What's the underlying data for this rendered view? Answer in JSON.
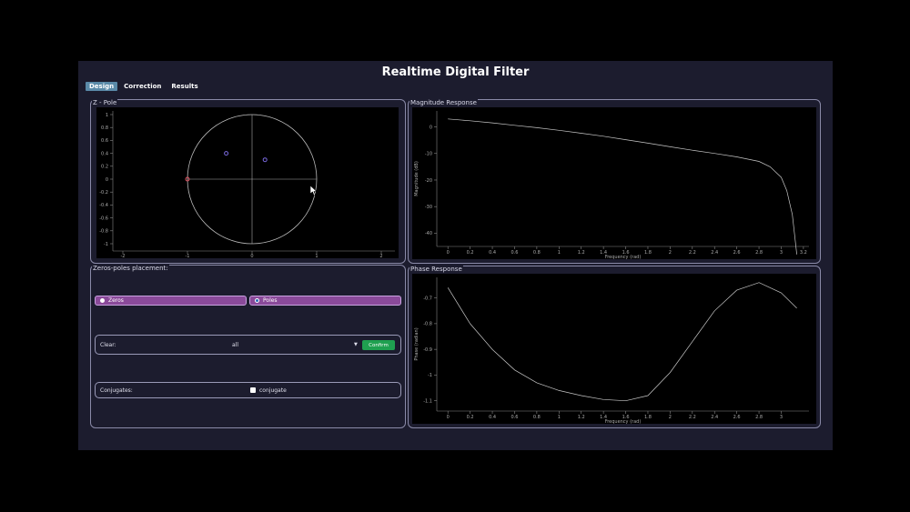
{
  "app": {
    "title": "Realtime Digital Filter"
  },
  "tabs": [
    {
      "label": "Design",
      "active": true
    },
    {
      "label": "Correction",
      "active": false
    },
    {
      "label": "Results",
      "active": false
    }
  ],
  "zpole": {
    "label": "Z - Pole",
    "x_ticks": [
      "-2",
      "-1",
      "0",
      "1",
      "2"
    ],
    "y_ticks": [
      "1",
      "0.8",
      "0.6",
      "0.4",
      "0.2",
      "0",
      "-0.2",
      "-0.4",
      "-0.6",
      "-0.8",
      "-1"
    ],
    "poles": [
      {
        "re": -0.4,
        "im": 0.4
      },
      {
        "re": 0.2,
        "im": 0.3
      }
    ],
    "zeros": [
      {
        "re": -1.0,
        "im": 0.0
      }
    ],
    "colors": {
      "pole": "#7a6adf",
      "zero": "#e05060",
      "circle": "#bbbbbb"
    }
  },
  "magnitude": {
    "label": "Magnitude Response",
    "xlabel": "Frequency (rad)",
    "ylabel": "Magnitude (dB)",
    "x_ticks": [
      "0",
      "0.2",
      "0.4",
      "0.6",
      "0.8",
      "1",
      "1.2",
      "1.4",
      "1.6",
      "1.8",
      "2",
      "2.2",
      "2.4",
      "2.6",
      "2.8",
      "3",
      "3.2"
    ],
    "y_ticks": [
      "0",
      "-10",
      "-20",
      "-30",
      "-40"
    ],
    "series": {
      "x": [
        0,
        0.2,
        0.4,
        0.6,
        0.8,
        1.0,
        1.2,
        1.4,
        1.6,
        1.8,
        2.0,
        2.2,
        2.4,
        2.6,
        2.8,
        2.9,
        3.0,
        3.05,
        3.1,
        3.14
      ],
      "y": [
        3,
        2.3,
        1.5,
        0.6,
        -0.3,
        -1.3,
        -2.4,
        -3.5,
        -4.8,
        -6.1,
        -7.5,
        -8.8,
        -10.0,
        -11.3,
        -13.0,
        -15,
        -19,
        -24,
        -33,
        -48
      ]
    }
  },
  "zeros_poles": {
    "label": "Zeros-poles placement:",
    "zeros_label": "Zeros",
    "poles_label": "Poles",
    "selected": "Poles",
    "clear_label": "Clear:",
    "clear_value": "all",
    "confirm_label": "Confirm",
    "conjugates_label": "Conjugates:",
    "conjugate_label": "conjugate"
  },
  "phase": {
    "label": "Phase Response",
    "xlabel": "Frequency (rad)",
    "ylabel": "Phase (radian)",
    "x_ticks": [
      "0",
      "0.2",
      "0.4",
      "0.6",
      "0.8",
      "1",
      "1.2",
      "1.4",
      "1.6",
      "1.8",
      "2",
      "2.2",
      "2.4",
      "2.6",
      "2.8",
      "3"
    ],
    "y_ticks": [
      "-0.7",
      "-0.8",
      "-0.9",
      "-1",
      "-1.1"
    ],
    "series": {
      "x": [
        0,
        0.2,
        0.4,
        0.6,
        0.8,
        1.0,
        1.2,
        1.4,
        1.6,
        1.8,
        2.0,
        2.2,
        2.4,
        2.6,
        2.8,
        3.0,
        3.14
      ],
      "y": [
        -0.66,
        -0.8,
        -0.9,
        -0.98,
        -1.03,
        -1.06,
        -1.08,
        -1.095,
        -1.1,
        -1.08,
        -0.99,
        -0.87,
        -0.75,
        -0.67,
        -0.64,
        -0.68,
        -0.74
      ]
    }
  }
}
